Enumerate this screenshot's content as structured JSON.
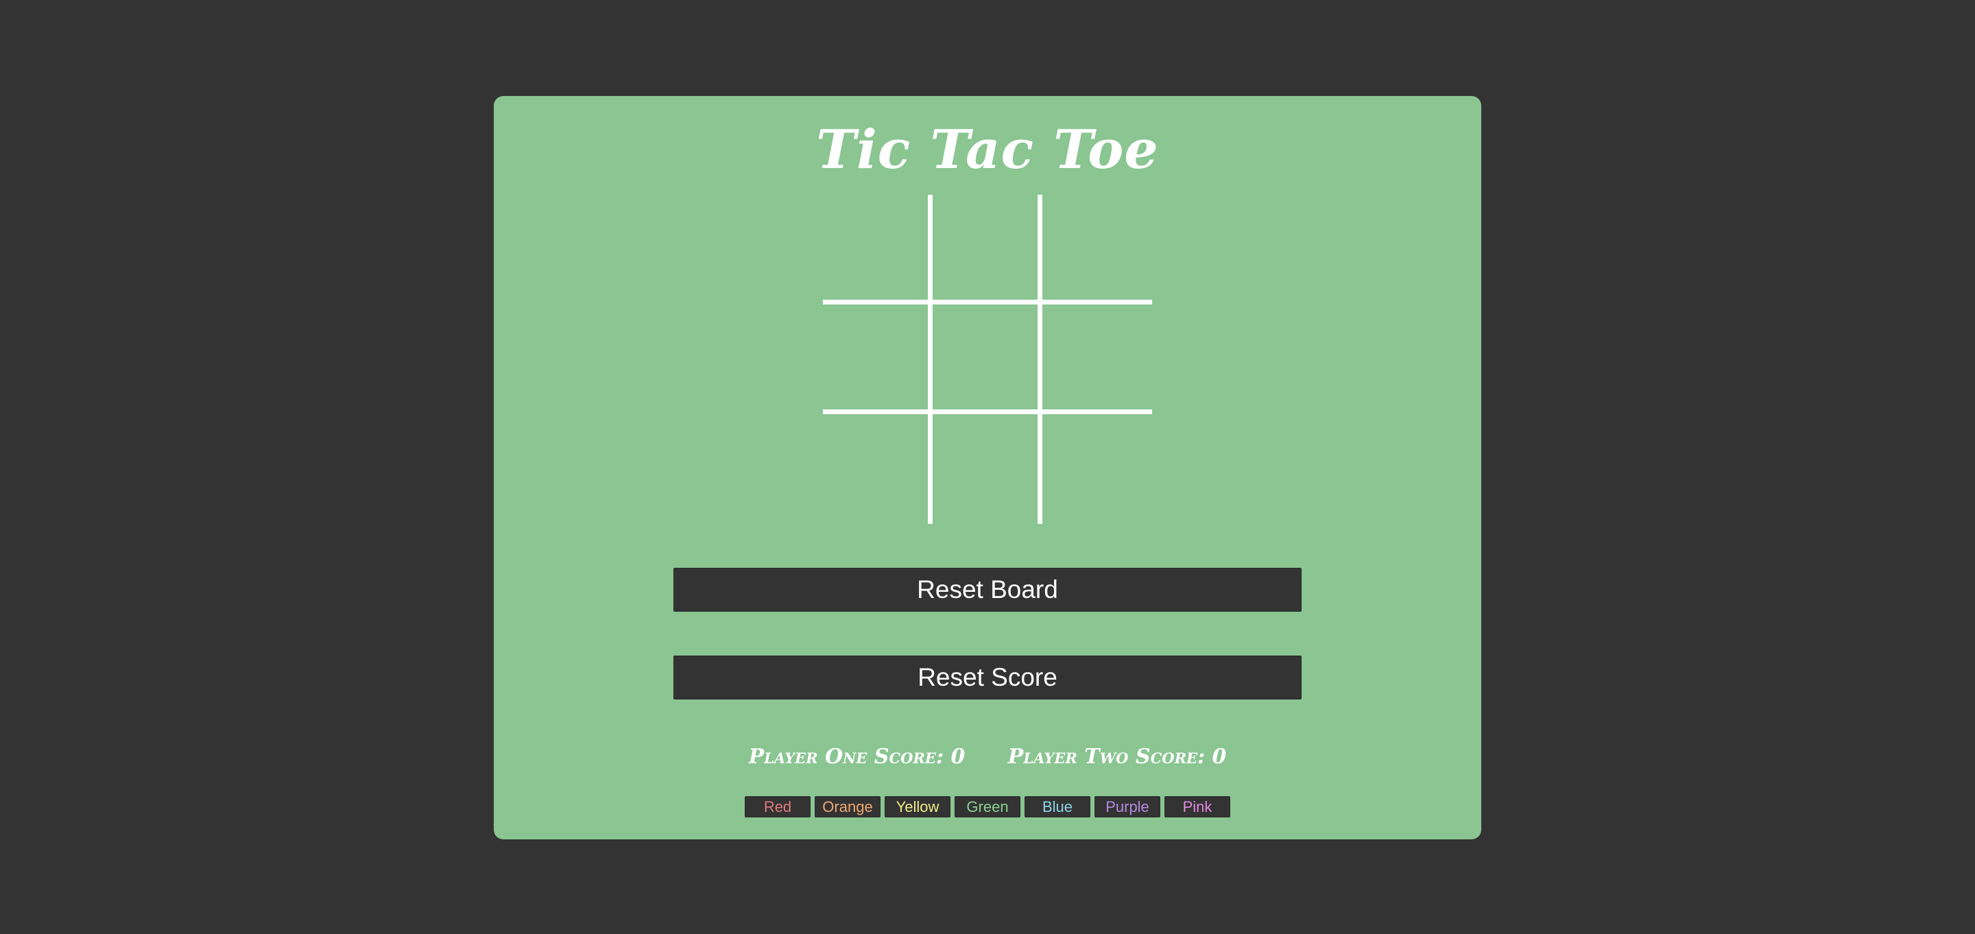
{
  "title": "Tic Tac Toe",
  "board": {
    "cells": [
      "",
      "",
      "",
      "",
      "",
      "",
      "",
      "",
      ""
    ]
  },
  "buttons": {
    "reset_board": "Reset Board",
    "reset_score": "Reset Score"
  },
  "scores": {
    "player_one": "Player One Score: 0",
    "player_two": "Player Two Score: 0"
  },
  "color_options": [
    {
      "label": "Red",
      "color": "#e07a7a"
    },
    {
      "label": "Orange",
      "color": "#f0a870"
    },
    {
      "label": "Yellow",
      "color": "#eeee88"
    },
    {
      "label": "Green",
      "color": "#8ad192"
    },
    {
      "label": "Blue",
      "color": "#8cd6e6"
    },
    {
      "label": "Purple",
      "color": "#b58ae0"
    },
    {
      "label": "Pink",
      "color": "#e08ae0"
    }
  ],
  "colors": {
    "background": "#333333",
    "panel": "#8ac592",
    "button": "#333333",
    "text": "#ffffff"
  }
}
